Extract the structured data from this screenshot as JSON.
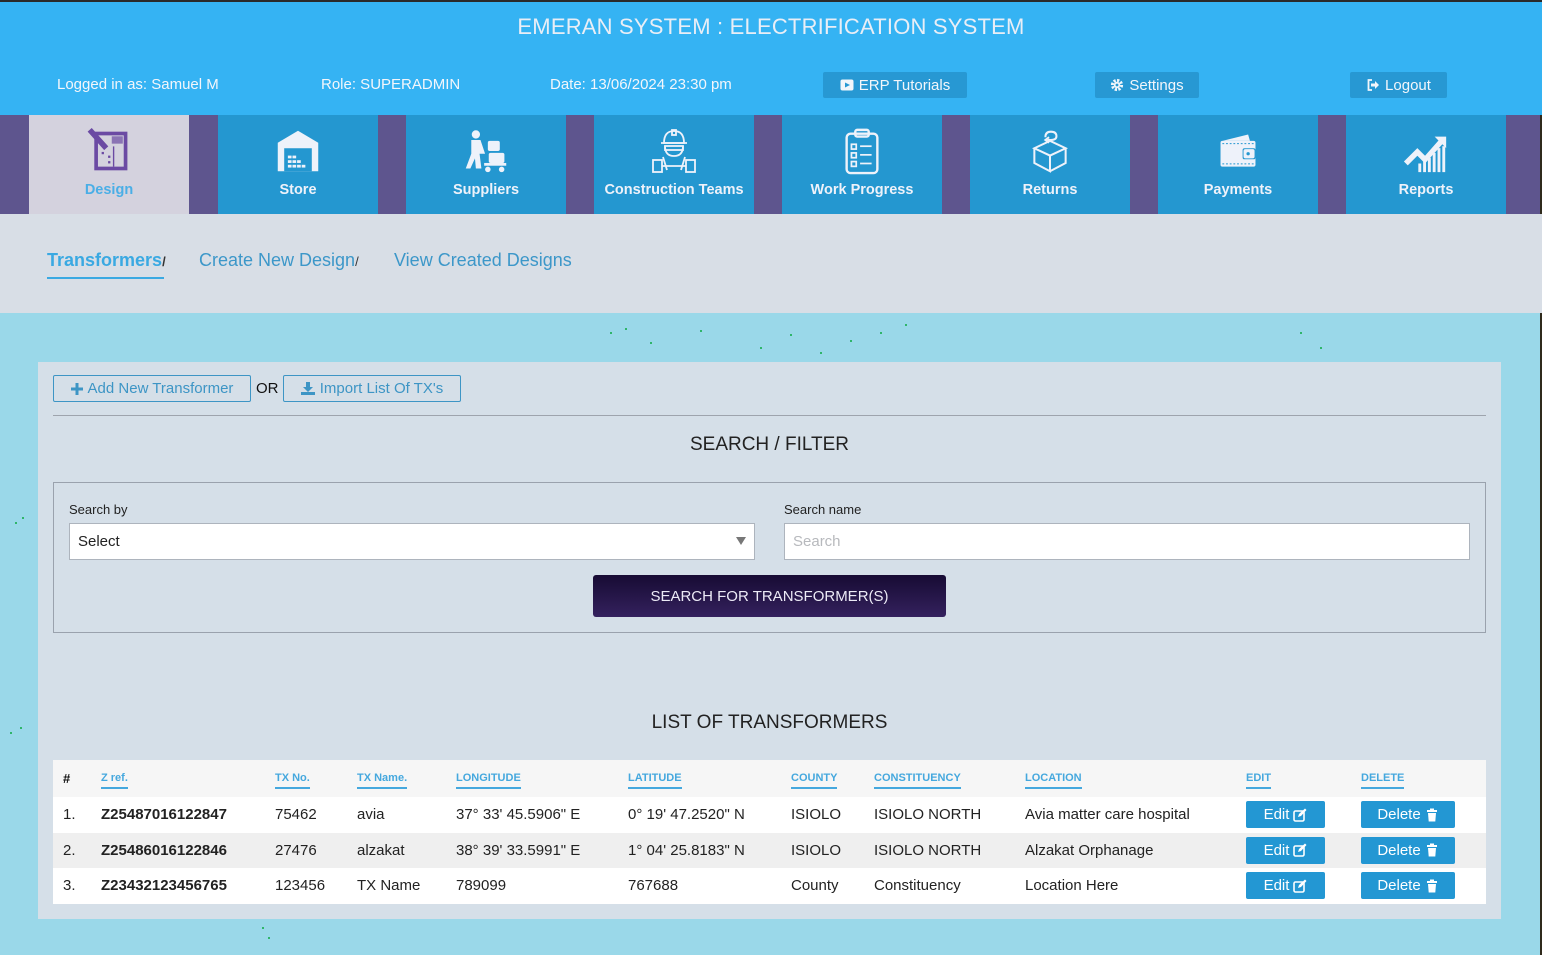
{
  "header": {
    "title": "EMERAN SYSTEM : ELECTRIFICATION SYSTEM",
    "logged_in": "Logged in as: Samuel M",
    "role": "Role: SUPERADMIN",
    "date": "Date: 13/06/2024 23:30 pm",
    "buttons": {
      "tutorials": "ERP Tutorials",
      "settings": "Settings",
      "logout": "Logout"
    }
  },
  "nav": {
    "items": [
      {
        "label": "Design",
        "icon": "design-blueprint-icon",
        "active": true
      },
      {
        "label": "Store",
        "icon": "warehouse-icon"
      },
      {
        "label": "Suppliers",
        "icon": "supplier-trolley-icon"
      },
      {
        "label": "Construction Teams",
        "icon": "construction-worker-icon"
      },
      {
        "label": "Work Progress",
        "icon": "clipboard-checklist-icon"
      },
      {
        "label": "Returns",
        "icon": "return-box-icon"
      },
      {
        "label": "Payments",
        "icon": "wallet-icon"
      },
      {
        "label": "Reports",
        "icon": "growth-chart-icon"
      }
    ]
  },
  "tabs": {
    "items": [
      {
        "label": "Transformers",
        "sep": "/",
        "active": true
      },
      {
        "label": "Create New Design",
        "sep": "/"
      },
      {
        "label": "View Created Designs",
        "sep": ""
      }
    ]
  },
  "actions": {
    "add": "Add New Transformer",
    "or": "OR",
    "import": "Import List Of TX's"
  },
  "filter": {
    "title": "SEARCH / FILTER",
    "search_by_label": "Search by",
    "search_by_value": "Select",
    "search_name_label": "Search name",
    "search_name_placeholder": "Search",
    "search_name_value": "",
    "submit": "SEARCH FOR TRANSFORMER(S)"
  },
  "list": {
    "title": "LIST OF TRANSFORMERS",
    "columns": [
      "#",
      "Z ref.",
      "TX No.",
      "TX Name.",
      "LONGITUDE",
      "LATITUDE",
      "COUNTY",
      "CONSTITUENCY",
      "LOCATION",
      "EDIT",
      "DELETE"
    ],
    "edit_label": "Edit",
    "delete_label": "Delete",
    "rows": [
      {
        "n": "1.",
        "zref": "Z25487016122847",
        "txno": "75462",
        "txname": "avia",
        "lon": "37° 33' 45.5906\" E",
        "lat": "0° 19' 47.2520\" N",
        "county": "ISIOLO",
        "constituency": "ISIOLO NORTH",
        "location": "Avia matter care hospital"
      },
      {
        "n": "2.",
        "zref": "Z25486016122846",
        "txno": "27476",
        "txname": "alzakat",
        "lon": "38° 39' 33.5991\" E",
        "lat": "1° 04' 25.8183\" N",
        "county": "ISIOLO",
        "constituency": "ISIOLO NORTH",
        "location": "Alzakat Orphanage"
      },
      {
        "n": "3.",
        "zref": "Z23432123456765",
        "txno": "123456",
        "txname": "TX Name",
        "lon": "789099",
        "lat": "767688",
        "county": "County",
        "constituency": "Constituency",
        "location": "Location Here"
      }
    ]
  },
  "colors": {
    "header_bg": "#35b3f3",
    "nav_item_bg": "#2497d0",
    "nav_gap": "#5e558e",
    "accent": "#2397d3",
    "search_button": "#241447"
  }
}
